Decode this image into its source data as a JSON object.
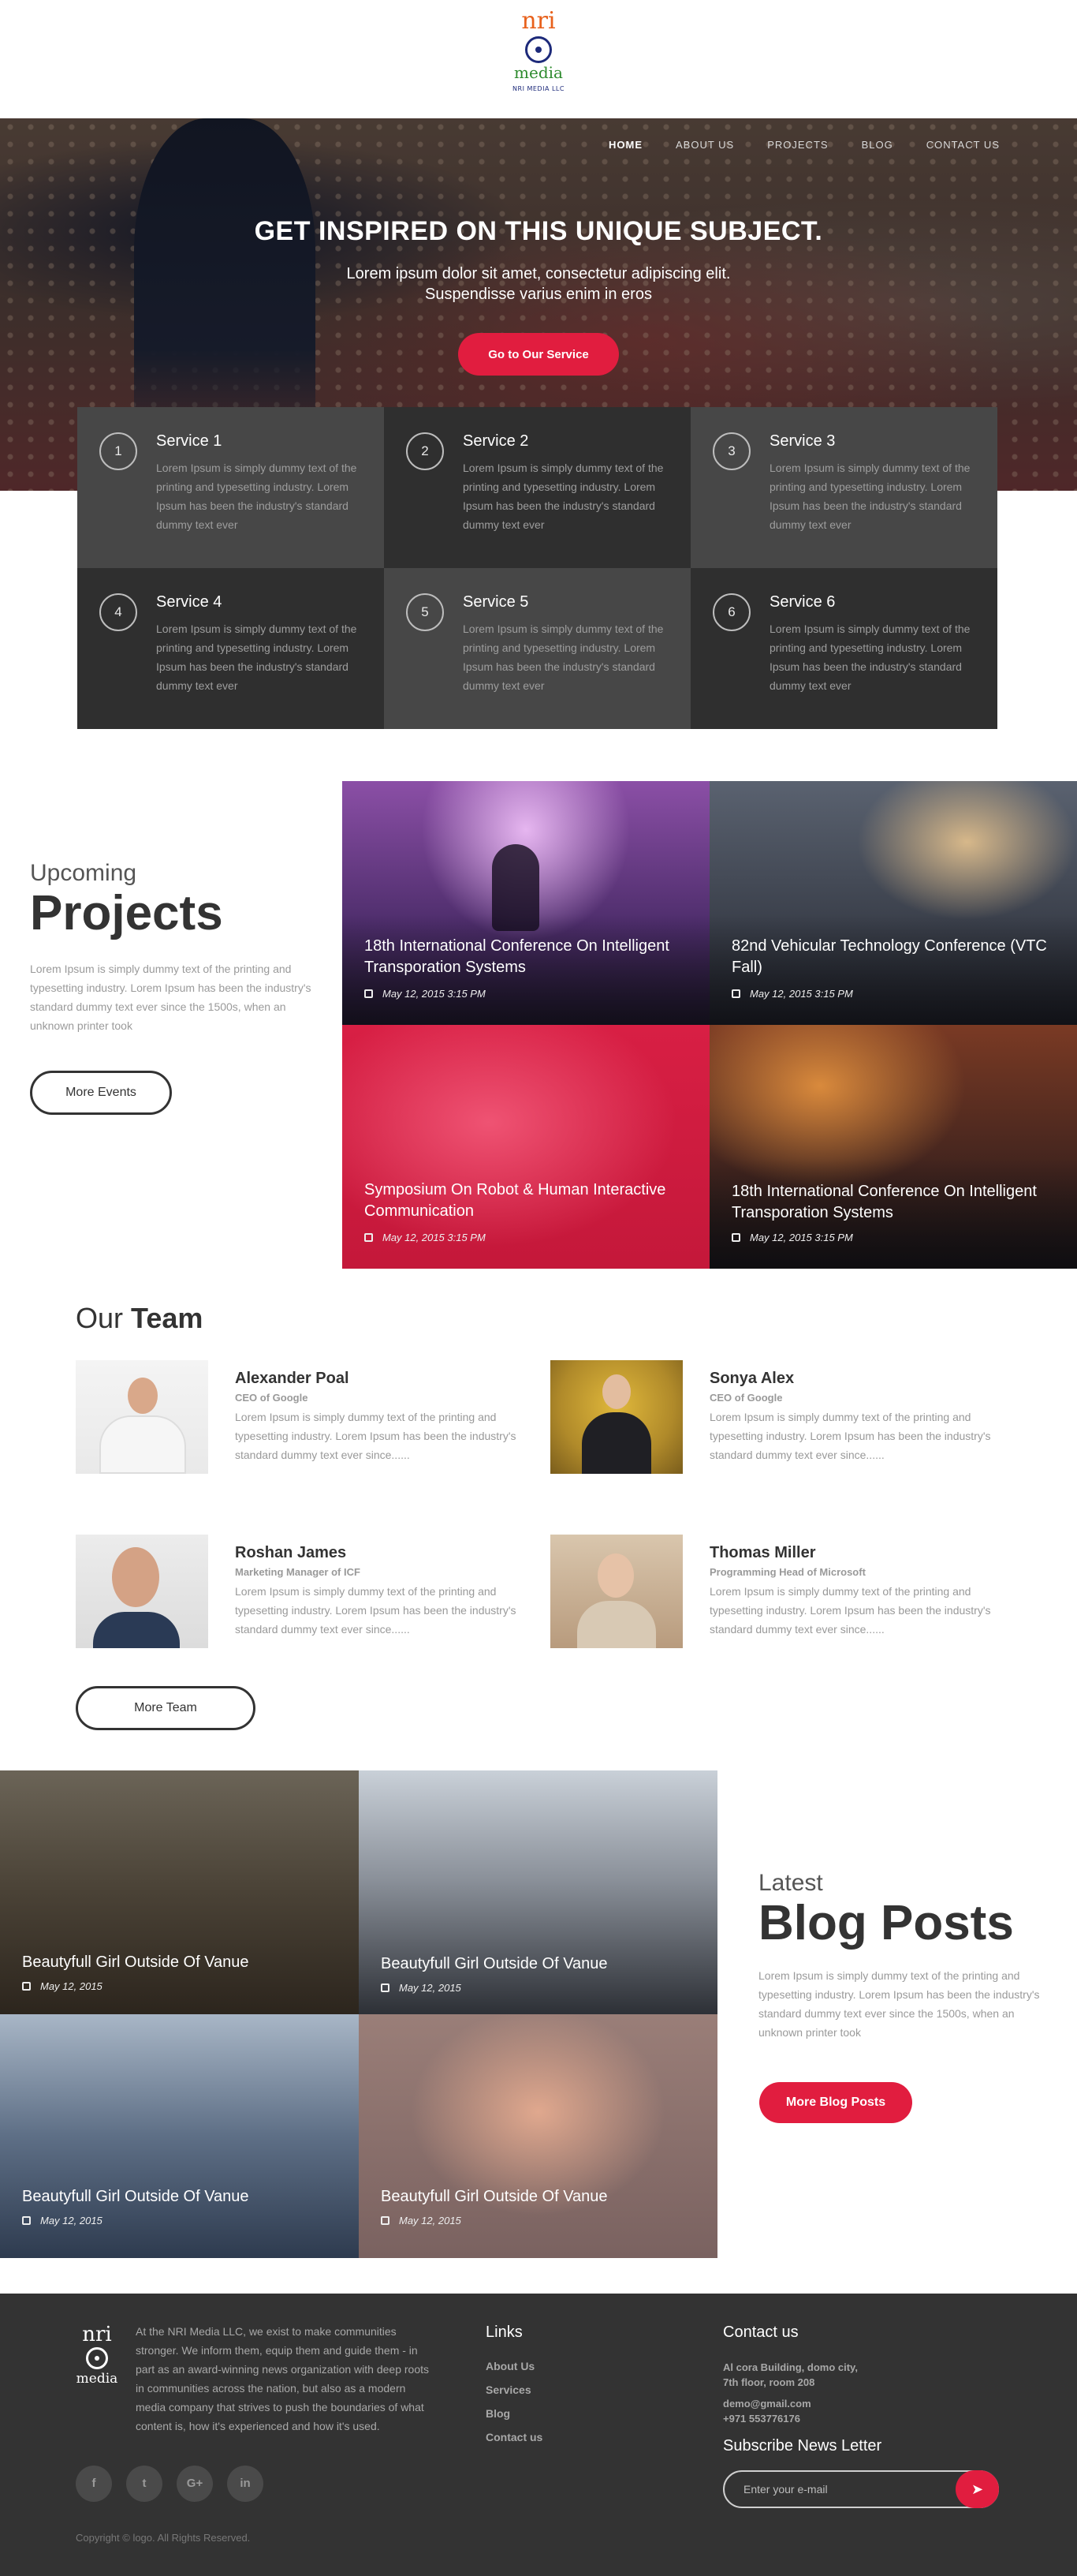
{
  "brand": {
    "logo_top": "nri",
    "logo_bottom": "media",
    "logo_caption": "NRI MEDIA LLC"
  },
  "nav": {
    "items": [
      "HOME",
      "ABOUT US",
      "PROJECTS",
      "BLOG",
      "CONTACT US"
    ],
    "active": "HOME"
  },
  "hero": {
    "title": "GET INSPIRED ON THIS UNIQUE SUBJECT.",
    "subtitle": "Lorem ipsum dolor sit amet, consectetur adipiscing elit. Suspendisse varius enim in eros",
    "button": "Go to Our Service"
  },
  "services": [
    {
      "num": "1",
      "title": "Service 1",
      "text": "Lorem Ipsum is simply dummy text of the printing and typesetting industry. Lorem Ipsum has been the industry's standard dummy text ever"
    },
    {
      "num": "2",
      "title": "Service 2",
      "text": "Lorem Ipsum is simply dummy text of the printing and typesetting industry. Lorem Ipsum has been the industry's standard dummy text ever"
    },
    {
      "num": "3",
      "title": "Service 3",
      "text": "Lorem Ipsum is simply dummy text of the printing and typesetting industry. Lorem Ipsum has been the industry's standard dummy text ever"
    },
    {
      "num": "4",
      "title": "Service 4",
      "text": "Lorem Ipsum is simply dummy text of the printing and typesetting industry. Lorem Ipsum has been the industry's standard dummy text ever"
    },
    {
      "num": "5",
      "title": "Service 5",
      "text": "Lorem Ipsum is simply dummy text of the printing and typesetting industry. Lorem Ipsum has been the industry's standard dummy text ever"
    },
    {
      "num": "6",
      "title": "Service 6",
      "text": "Lorem Ipsum is simply dummy text of the printing and typesetting industry. Lorem Ipsum has been the industry's standard dummy text ever"
    }
  ],
  "projects": {
    "eyebrow": "Upcoming",
    "heading": "Projects",
    "text": "Lorem Ipsum is simply dummy text of the printing and typesetting industry. Lorem Ipsum has been the industry's standard dummy text ever since the 1500s, when an unknown printer took",
    "button": "More Events",
    "items": [
      {
        "title": "18th International Conference On Intelligent Transporation Systems",
        "date": "May 12, 2015 3:15 PM"
      },
      {
        "title": "82nd Vehicular Technology Conference (VTC Fall)",
        "date": "May 12, 2015 3:15 PM"
      },
      {
        "title": "Symposium On Robot & Human Interactive Communication",
        "date": "May 12, 2015 3:15 PM"
      },
      {
        "title": "18th International Conference On Intelligent Transporation Systems",
        "date": "May 12, 2015 3:15 PM"
      }
    ]
  },
  "team": {
    "heading_light": "Our",
    "heading_bold": "Team",
    "button": "More Team",
    "members": [
      {
        "name": "Alexander Poal",
        "role": "CEO of Google",
        "bio": "Lorem Ipsum is simply dummy text of the printing and typesetting industry. Lorem Ipsum has been the industry's standard dummy text ever since......"
      },
      {
        "name": "Sonya Alex",
        "role": "CEO of Google",
        "bio": "Lorem Ipsum is simply dummy text of the printing and typesetting industry. Lorem Ipsum has been the industry's standard dummy text ever since......"
      },
      {
        "name": "Roshan James",
        "role": "Marketing Manager of ICF",
        "bio": "Lorem Ipsum is simply dummy text of the printing and typesetting industry. Lorem Ipsum has been the industry's standard dummy text ever since......"
      },
      {
        "name": "Thomas Miller",
        "role": "Programming Head of Microsoft",
        "bio": "Lorem Ipsum is simply dummy text of the printing and typesetting industry. Lorem Ipsum has been the industry's standard dummy text ever since......"
      }
    ]
  },
  "blog": {
    "eyebrow": "Latest",
    "heading": "Blog Posts",
    "text": "Lorem Ipsum is simply dummy text of the printing and typesetting industry. Lorem Ipsum has been the industry's standard dummy text ever since the 1500s, when an unknown printer took",
    "button": "More Blog Posts",
    "posts": [
      {
        "title": "Beautyfull Girl Outside Of Vanue",
        "date": "May 12, 2015"
      },
      {
        "title": "Beautyfull Girl Outside Of Vanue",
        "date": "May 12, 2015"
      },
      {
        "title": "Beautyfull Girl Outside Of Vanue",
        "date": "May 12, 2015"
      },
      {
        "title": "Beautyfull Girl Outside Of Vanue",
        "date": "May 12, 2015"
      }
    ]
  },
  "footer": {
    "about": "At the NRI Media LLC, we exist to make communities stronger. We inform them, equip them and guide them - in part as an award-winning news organization with deep roots in communities across the nation, but also as a modern media company that strives to push the boundaries of what content is, how it's experienced and how it's used.",
    "socials": [
      "f",
      "t",
      "G+",
      "in"
    ],
    "copyright": "Copyright © logo. All Rights Reserved.",
    "links_heading": "Links",
    "links": [
      "About Us",
      "Services",
      "Blog",
      "Contact us"
    ],
    "contact_heading": "Contact us",
    "address_line1": "Al cora Building, domo city,",
    "address_line2": "7th floor, room 208",
    "email": "demo@gmail.com",
    "phone": "+971 553776176",
    "subscribe_heading": "Subscribe News Letter",
    "email_placeholder": "Enter your e-mail"
  },
  "colors": {
    "accent": "#e11d3f",
    "dark": "#333333",
    "service_dark": "#2f2f2f",
    "service_light": "#474747"
  }
}
